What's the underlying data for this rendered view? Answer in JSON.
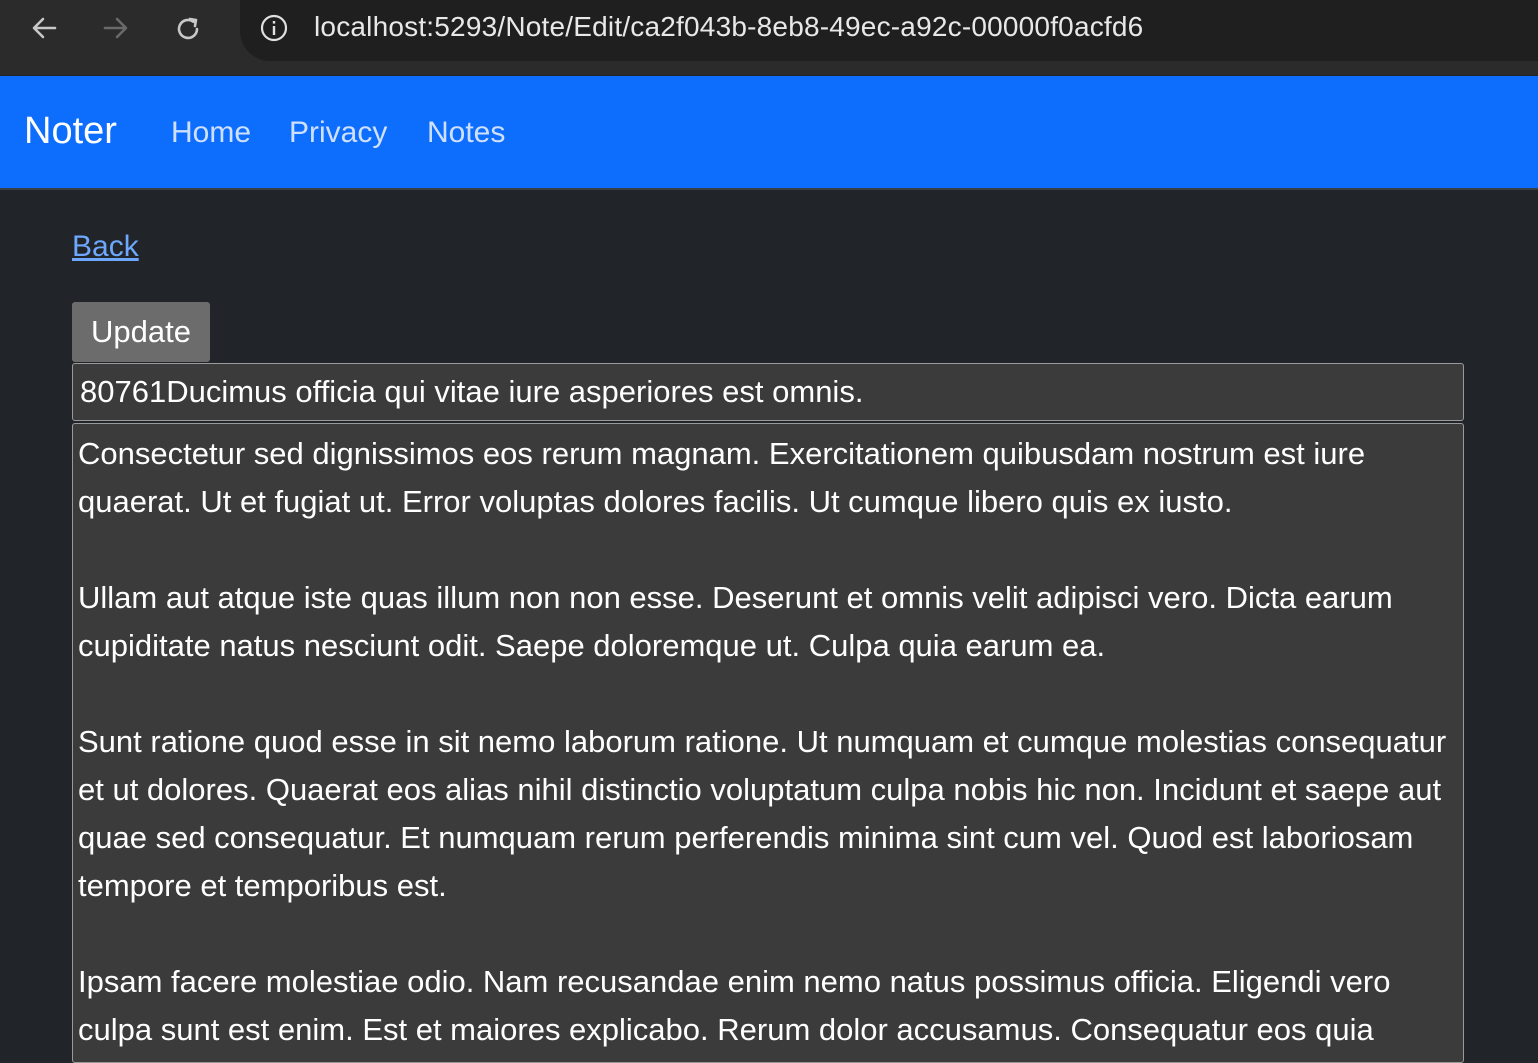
{
  "browser": {
    "url": "localhost:5293/Note/Edit/ca2f043b-8eb8-49ec-a92c-00000f0acfd6",
    "icons": [
      "back-arrow-icon",
      "forward-arrow-icon",
      "reload-icon",
      "site-info-icon"
    ]
  },
  "navbar": {
    "brand": "Noter",
    "links": [
      "Home",
      "Privacy",
      "Notes"
    ],
    "color": "#0d6efd"
  },
  "page": {
    "back_label": "Back",
    "update_label": "Update",
    "title_value": "80761Ducimus officia qui vitae iure asperiores est omnis.",
    "body_value": "Consectetur sed dignissimos eos rerum magnam. Exercitationem quibusdam nostrum est iure quaerat. Ut et fugiat ut. Error voluptas dolores facilis. Ut cumque libero quis ex iusto.\n\nUllam aut atque iste quas illum non non esse. Deserunt et omnis velit adipisci vero. Dicta earum cupiditate natus nesciunt odit. Saepe doloremque ut. Culpa quia earum ea.\n\nSunt ratione quod esse in sit nemo laborum ratione. Ut numquam et cumque molestias consequatur et ut dolores. Quaerat eos alias nihil distinctio voluptatum culpa nobis hic non. Incidunt et saepe aut quae sed consequatur. Et numquam rerum perferendis minima sint cum vel. Quod est laboriosam tempore et temporibus est.\n\nIpsam facere molestiae odio. Nam recusandae enim nemo natus possimus officia. Eligendi vero culpa sunt est enim. Est et maiores explicabo. Rerum dolor accusamus. Consequatur eos quia"
  }
}
